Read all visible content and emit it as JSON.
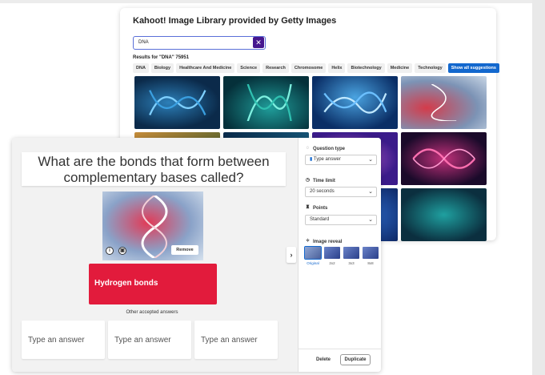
{
  "library": {
    "title": "Kahoot! Image Library provided by Getty Images",
    "search_value": "DNA",
    "results_text": "Results for \"DNA\" 75951",
    "chips": [
      "DNA",
      "Biology",
      "Healthcare And Medicine",
      "Science",
      "Research",
      "Chromosome",
      "Helix",
      "Biotechnology",
      "Medicine",
      "Technology"
    ],
    "show_all": "Show all suggestions"
  },
  "question": {
    "text": "What are the bonds that form between complementary bases called?",
    "remove_label": "Remove",
    "correct_answer": "Hydrogen bonds",
    "other_label": "Other accepted answers",
    "answer_placeholders": [
      "Type an answer",
      "Type an answer",
      "Type an answer"
    ]
  },
  "settings": {
    "question_type_label": "Question type",
    "question_type_value": "Type answer",
    "time_limit_label": "Time limit",
    "time_limit_value": "20 seconds",
    "points_label": "Points",
    "points_value": "Standard",
    "image_reveal_label": "Image reveal",
    "reveal_options": [
      "Original",
      "2x2",
      "3x3",
      "8x8"
    ],
    "delete_label": "Delete",
    "duplicate_label": "Duplicate"
  },
  "colors": {
    "answer_red": "#e21b3c",
    "primary_blue": "#1368ce",
    "kahoot_purple": "#46178f"
  }
}
